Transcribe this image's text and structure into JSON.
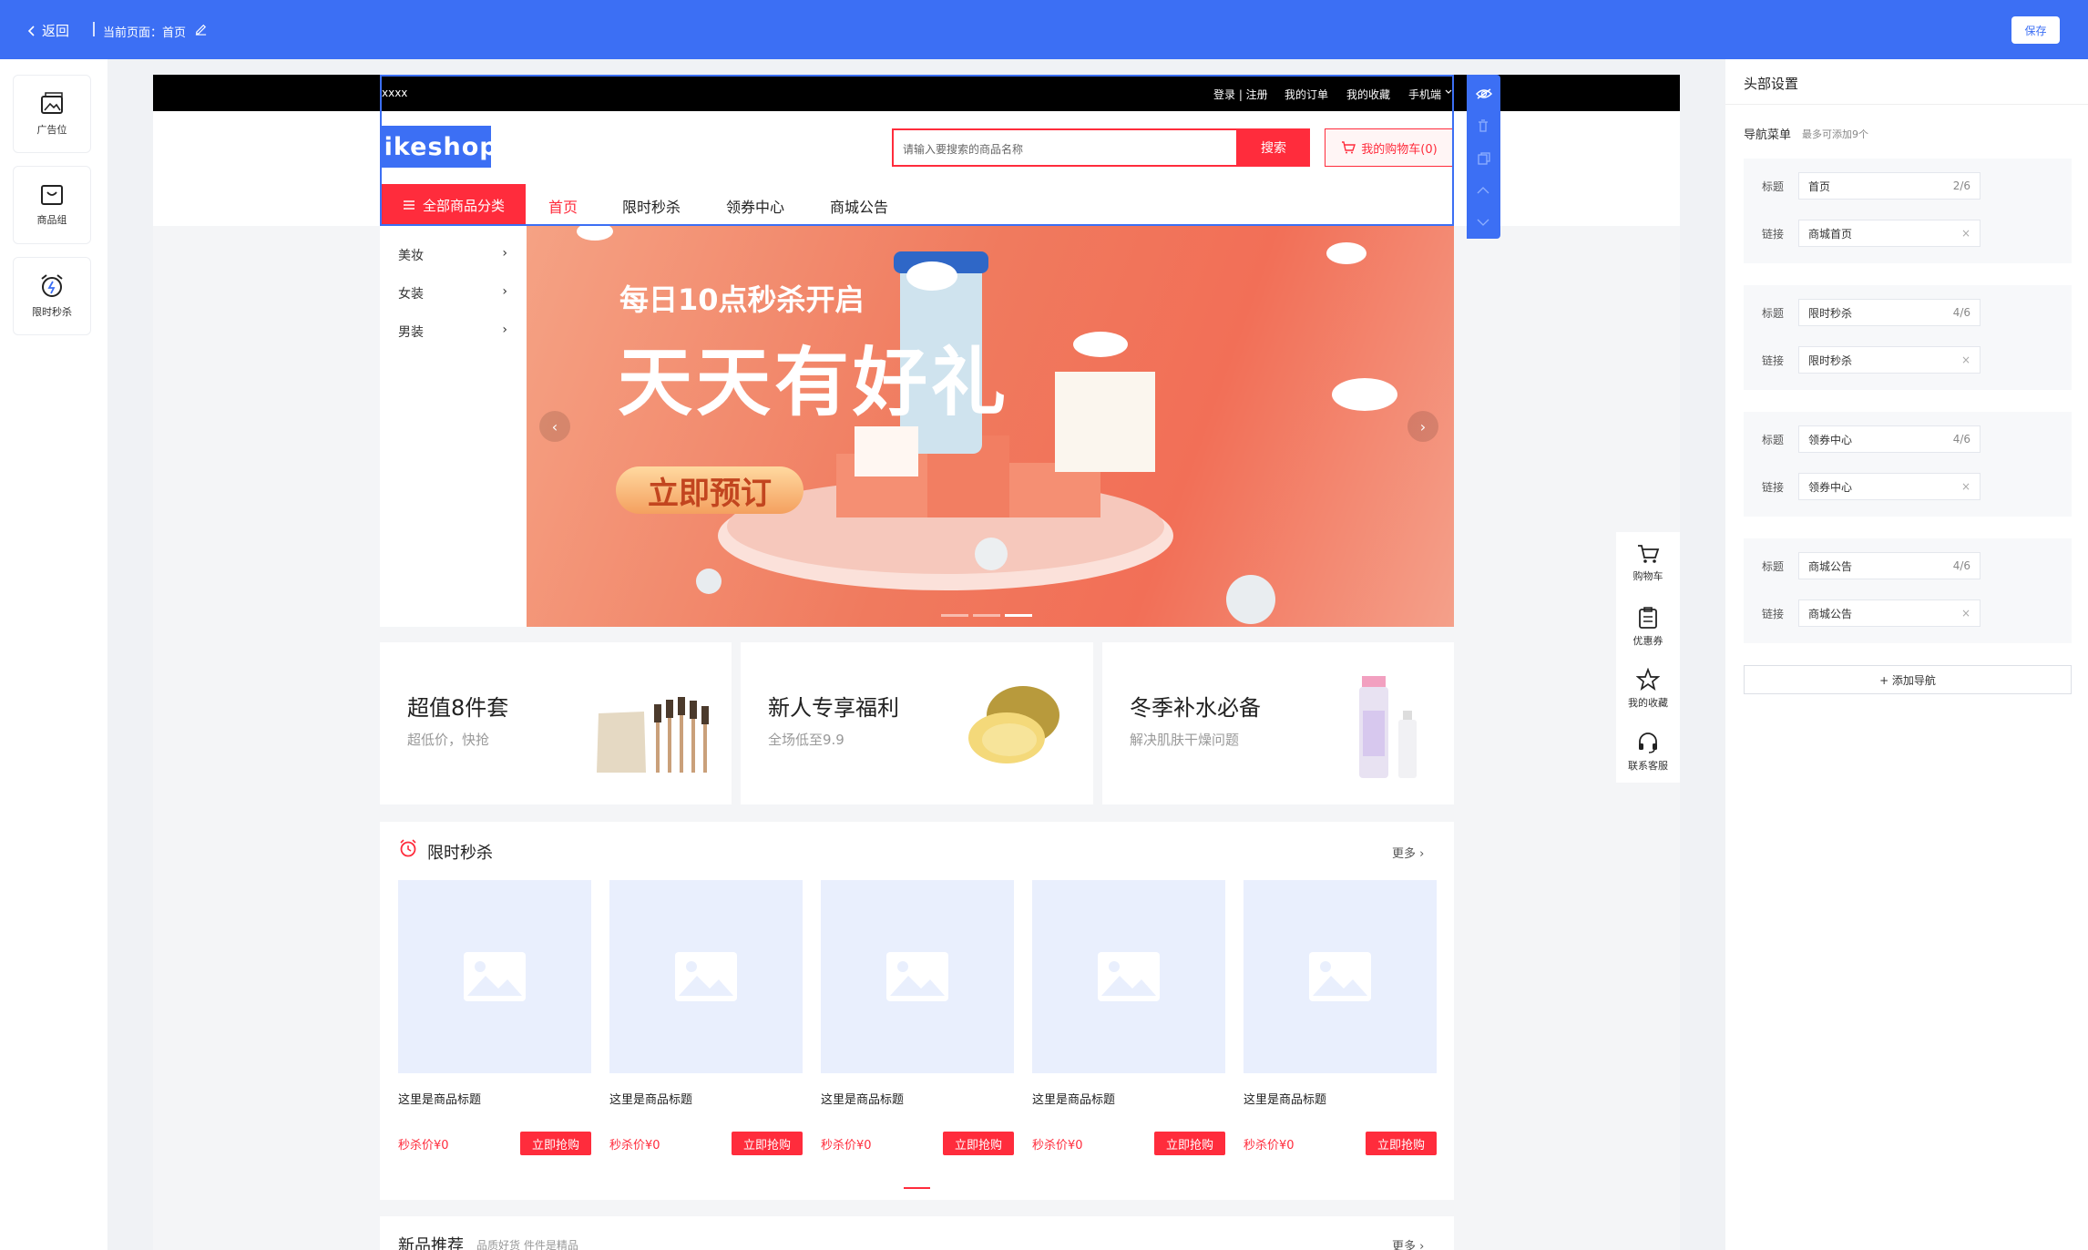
{
  "topbar": {
    "back_label": "返回",
    "current_page": "当前页面：首页",
    "save_label": "保存"
  },
  "left_widgets": [
    {
      "label": "广告位",
      "icon": "image-icon"
    },
    {
      "label": "商品组",
      "icon": "bag-icon"
    },
    {
      "label": "限时秒杀",
      "icon": "alarm-clock-icon"
    }
  ],
  "shop": {
    "topbar_left": "xxxx",
    "topbar_links": [
      "登录 | 注册",
      "我的订单",
      "我的收藏",
      "手机端"
    ],
    "logo": "likeshop",
    "search_placeholder": "请输入要搜索的商品名称",
    "search_button": "搜索",
    "cart_label": "我的购物车(0)",
    "all_categories": "全部商品分类",
    "nav": [
      "首页",
      "限时秒杀",
      "领券中心",
      "商城公告"
    ],
    "categories": [
      "美妆",
      "女装",
      "男装"
    ]
  },
  "banner": {
    "subtitle": "每日10点秒杀开启",
    "title": "天天有好礼",
    "cta": "立即预订",
    "prev": "‹",
    "next": "›"
  },
  "right_float": [
    {
      "label": "购物车",
      "icon": "cart-icon"
    },
    {
      "label": "优惠券",
      "icon": "coupon-icon"
    },
    {
      "label": "我的收藏",
      "icon": "star-icon"
    },
    {
      "label": "联系客服",
      "icon": "headset-icon"
    }
  ],
  "promos": [
    {
      "title": "超值8件套",
      "subtitle": "超低价，快抢"
    },
    {
      "title": "新人专享福利",
      "subtitle": "全场低至9.9"
    },
    {
      "title": "冬季补水必备",
      "subtitle": "解决肌肤干燥问题"
    }
  ],
  "flash_sale": {
    "title": "限时秒杀",
    "more": "更多",
    "products": [
      {
        "title": "这里是商品标题",
        "price": "秒杀价¥0",
        "buy": "立即抢购"
      },
      {
        "title": "这里是商品标题",
        "price": "秒杀价¥0",
        "buy": "立即抢购"
      },
      {
        "title": "这里是商品标题",
        "price": "秒杀价¥0",
        "buy": "立即抢购"
      },
      {
        "title": "这里是商品标题",
        "price": "秒杀价¥0",
        "buy": "立即抢购"
      },
      {
        "title": "这里是商品标题",
        "price": "秒杀价¥0",
        "buy": "立即抢购"
      }
    ]
  },
  "new_products": {
    "title": "新品推荐",
    "subtitle": "品质好货 件件是精品",
    "more": "更多"
  },
  "settings": {
    "panel_title": "头部设置",
    "nav_menu_label": "导航菜单",
    "nav_menu_hint": "最多可添加9个",
    "title_label": "标题",
    "link_label": "链接",
    "items": [
      {
        "title": "首页",
        "count": "2/6",
        "link": "商城首页"
      },
      {
        "title": "限时秒杀",
        "count": "4/6",
        "link": "限时秒杀"
      },
      {
        "title": "领券中心",
        "count": "4/6",
        "link": "领券中心"
      },
      {
        "title": "商城公告",
        "count": "4/6",
        "link": "商城公告"
      }
    ],
    "add_nav": "+ 添加导航"
  },
  "colors": {
    "primary": "#3c6ff4",
    "accent": "#ff2c3c"
  }
}
